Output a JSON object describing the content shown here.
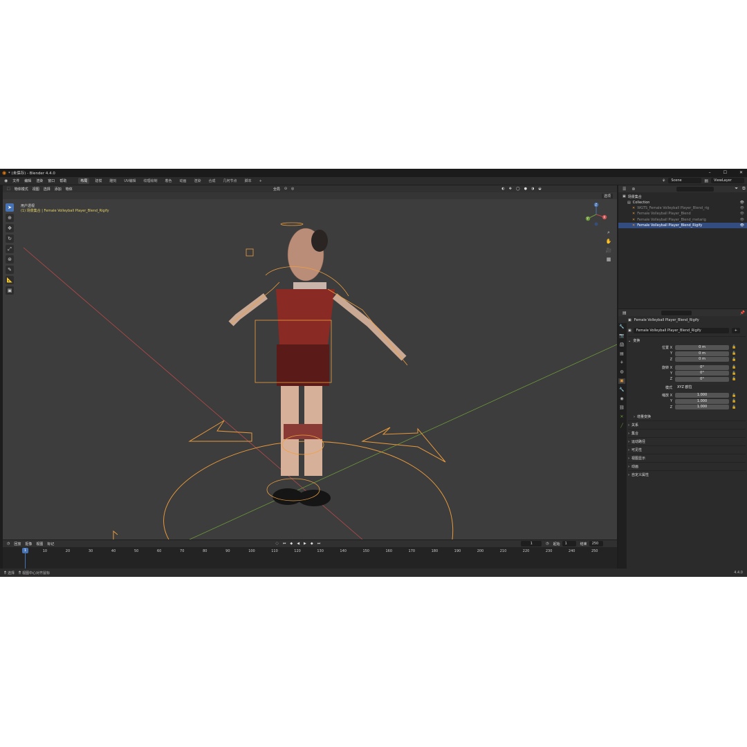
{
  "window": {
    "title": "* (未保存) - Blender 4.4.0"
  },
  "menubar": {
    "menus": [
      "文件",
      "编辑",
      "渲染",
      "窗口",
      "帮助"
    ],
    "workspaces": [
      "布局",
      "建模",
      "雕刻",
      "UV编辑",
      "纹理绘制",
      "着色",
      "动画",
      "渲染",
      "合成",
      "几何节点",
      "脚本"
    ],
    "active_workspace": 0,
    "add": "+",
    "scene": "Scene",
    "view_layer": "ViewLayer"
  },
  "viewport": {
    "mode": "物体模式",
    "menus": [
      "视图",
      "选择",
      "添加",
      "物体"
    ],
    "transform_orientation": "全局",
    "options_label": "选项",
    "overlay_view": "用户透视",
    "overlay_object": "(1) 场景集合 | Female Volleyball Player_Blend_Rigify",
    "axes": {
      "x": "X",
      "y": "Y",
      "z": "Z"
    }
  },
  "timeline": {
    "menus": [
      "回放",
      "抠像",
      "视图",
      "标记"
    ],
    "current_frame": "1",
    "start_label": "起始",
    "start": "1",
    "end_label": "结束",
    "end": "250",
    "ticks": [
      10,
      20,
      30,
      40,
      50,
      60,
      70,
      80,
      90,
      100,
      110,
      120,
      130,
      140,
      150,
      160,
      170,
      180,
      190,
      200,
      210,
      220,
      230,
      240,
      250
    ]
  },
  "statusbar": {
    "left1": "选择",
    "left2": "视图中心对齐鼠标",
    "version": "4.4.0"
  },
  "outliner": {
    "search_placeholder": "",
    "rows": [
      {
        "label": "场景集合",
        "indent": 0,
        "dim": false,
        "selected": false
      },
      {
        "label": "Collection",
        "indent": 1,
        "dim": false,
        "selected": false
      },
      {
        "label": "WGTS_Female Volleyball Player_Blend_rig",
        "indent": 2,
        "dim": true,
        "selected": false
      },
      {
        "label": "Female Volleyball Player_Blend",
        "indent": 2,
        "dim": true,
        "selected": false
      },
      {
        "label": "Female Volleyball Player_Blend_metarig",
        "indent": 2,
        "dim": true,
        "selected": false
      },
      {
        "label": "Female Volleyball Player_Blend_Rigify",
        "indent": 2,
        "dim": false,
        "selected": true
      }
    ]
  },
  "properties": {
    "object_name": "Female Volleyball Player_Blend_Rigify",
    "object_field": "Female Volleyball Player_Blend_Rigify",
    "transform_title": "变换",
    "location_label": "位置 X",
    "location": [
      "0 m",
      "0 m",
      "0 m"
    ],
    "rotation_label": "旋转 X",
    "rotation": [
      "0°",
      "0°",
      "0°"
    ],
    "mode_label": "模式",
    "mode_value": "XYZ 欧拉",
    "scale_label": "缩放 X",
    "scale": [
      "1.000",
      "1.000",
      "1.000"
    ],
    "axis_y": "Y",
    "axis_z": "Z",
    "delta_transform": "增量变换",
    "sections": [
      "关系",
      "集合",
      "运动路径",
      "可见性",
      "视图显示",
      "动画",
      "自定义属性"
    ]
  },
  "colors": {
    "accent": "#4772b3",
    "selection": "#e89a3c",
    "background": "#3d3d3d"
  }
}
